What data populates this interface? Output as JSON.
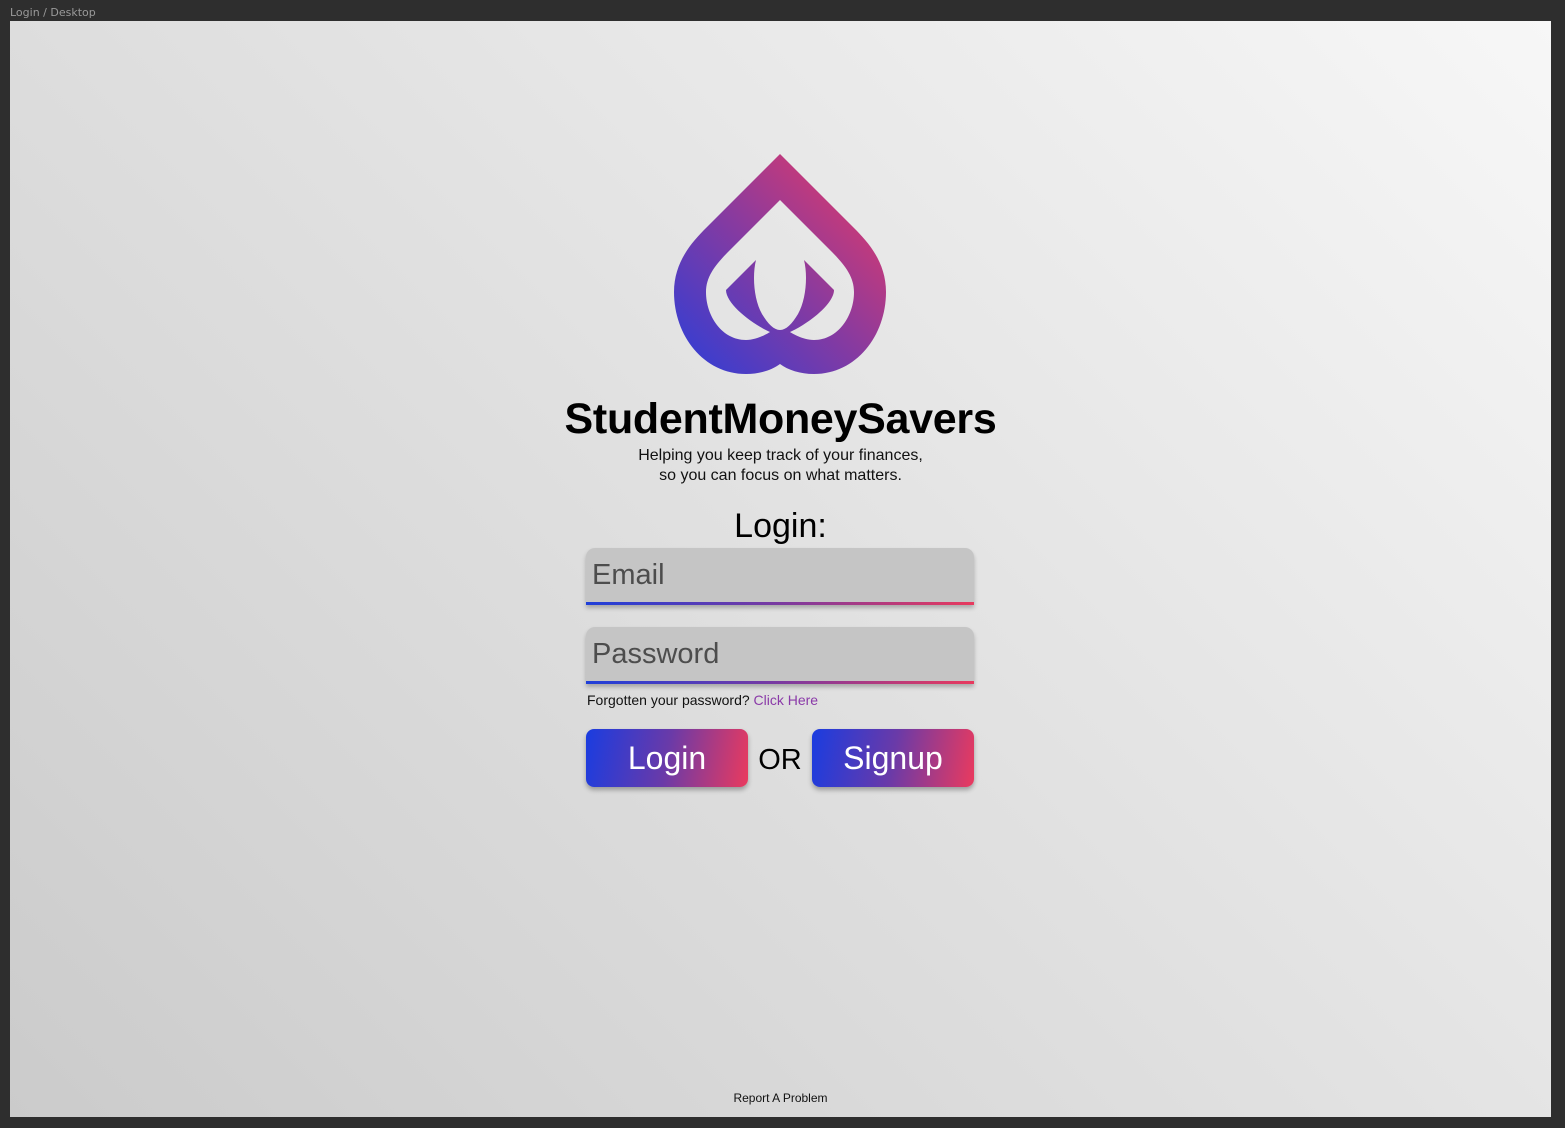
{
  "canvas": {
    "frame_label": "Login / Desktop"
  },
  "brand": {
    "logo_icon": "purple-gradient-drop-logo-icon",
    "title": "StudentMoneySavers",
    "tagline_line1": "Helping you keep track of your finances,",
    "tagline_line2": "so you can focus on what matters."
  },
  "login_form": {
    "heading": "Login:",
    "email_placeholder": "Email",
    "password_placeholder": "Password",
    "forgot_text": "Forgotten your password?",
    "forgot_link": "Click Here",
    "login_button": "Login",
    "or_text": "OR",
    "signup_button": "Signup"
  },
  "footer": {
    "report_link": "Report A Problem"
  },
  "colors": {
    "gradient_start": "#1a3ce0",
    "gradient_mid": "#7a3aa0",
    "gradient_end": "#ea3a5e",
    "link": "#8a3aa8",
    "field_bg": "#c5c5c5"
  }
}
